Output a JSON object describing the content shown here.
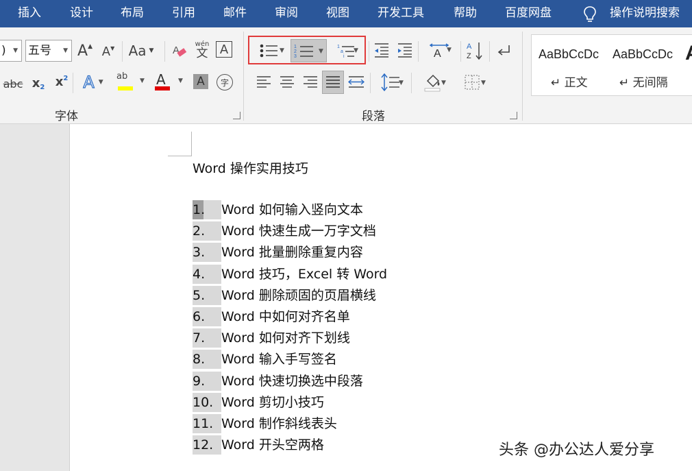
{
  "menu": {
    "items": [
      "插入",
      "设计",
      "布局",
      "引用",
      "邮件",
      "审阅",
      "视图",
      "开发工具",
      "帮助",
      "百度网盘"
    ],
    "tell_me": "操作说明搜索"
  },
  "font_group": {
    "font_name_partial": ")",
    "font_size": "五号",
    "case_label": "Aa",
    "pinyin_label": "wén",
    "pinyin_char": "文",
    "border_char": "A",
    "strike_label": "abc",
    "subscript_label": "x",
    "subscript_mark": "2",
    "superscript_label": "x",
    "superscript_mark": "2",
    "effects_label": "A",
    "highlight_label": "ab",
    "font_color_label": "A",
    "shading_label": "A",
    "enclose_char": "字",
    "grow_label": "A",
    "shrink_label": "A",
    "label": "字体"
  },
  "paragraph_group": {
    "label": "段落",
    "sort_label": "A"
  },
  "styles": {
    "sample1": "AaBbCcDc",
    "sample2": "AaBbCcDc",
    "name1": "正文",
    "name2": "无间隔",
    "para_mark": "↵",
    "sample3": "A"
  },
  "colors": {
    "ribbon_blue": "#2b579a",
    "highlight_red": "#e03a3a",
    "highlighter_yellow": "#ffff00",
    "font_color_red": "#e00000"
  },
  "document": {
    "title": "Word 操作实用技巧",
    "items": [
      {
        "num": "1.",
        "text": "Word 如何输入竖向文本"
      },
      {
        "num": "2.",
        "text": "Word 快速生成一万字文档"
      },
      {
        "num": "3.",
        "text": "Word 批量删除重复内容"
      },
      {
        "num": "4.",
        "text": "Word 技巧，Excel 转 Word"
      },
      {
        "num": "5.",
        "text": "Word 删除顽固的页眉横线"
      },
      {
        "num": "6.",
        "text": "Word 中如何对齐名单"
      },
      {
        "num": "7.",
        "text": "Word 如何对齐下划线"
      },
      {
        "num": "8.",
        "text": "Word 输入手写签名"
      },
      {
        "num": "9.",
        "text": "Word 快速切换选中段落"
      },
      {
        "num": "10.",
        "text": "Word 剪切小技巧"
      },
      {
        "num": "11.",
        "text": "Word 制作斜线表头"
      },
      {
        "num": "12.",
        "text": "Word 开头空两格"
      }
    ]
  },
  "watermark": "头条 @办公达人爱分享"
}
